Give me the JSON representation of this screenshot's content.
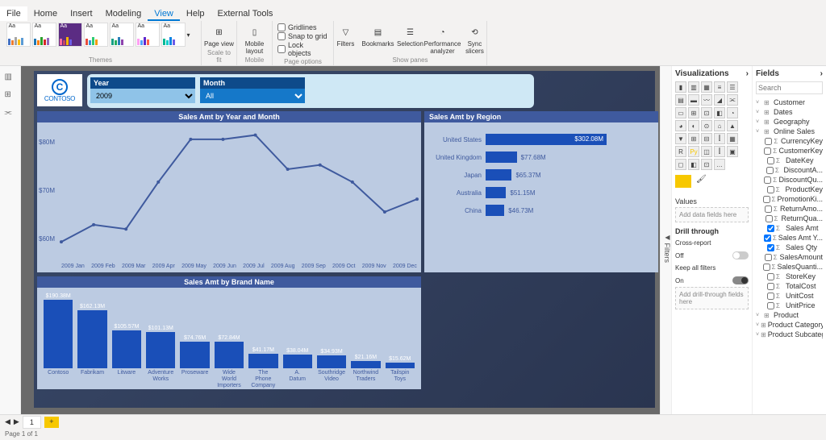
{
  "menu": {
    "file": "File",
    "home": "Home",
    "insert": "Insert",
    "modeling": "Modeling",
    "view": "View",
    "help": "Help",
    "external": "External Tools"
  },
  "ribbon": {
    "themes_label": "Themes",
    "scale_label": "Scale to fit",
    "mobile_label": "Mobile",
    "page_label": "Page options",
    "show_label": "Show panes",
    "page_view": "Page view",
    "mobile_layout": "Mobile layout",
    "gridlines": "Gridlines",
    "snap": "Snap to grid",
    "lock": "Lock objects",
    "filters": "Filters",
    "bookmarks": "Bookmarks",
    "selection": "Selection",
    "perf": "Performance analyzer",
    "sync": "Sync slicers"
  },
  "logo": {
    "name": "CONTOSO",
    "glyph": "C"
  },
  "slicers": {
    "year_label": "Year",
    "month_label": "Month",
    "year_value": "2009",
    "month_value": "All"
  },
  "titles": {
    "line": "Sales Amt by Year and Month",
    "region": "Sales Amt by Region",
    "brand": "Sales Amt by Brand Name"
  },
  "filters_label": "Filters",
  "viz": {
    "title": "Visualizations",
    "values": "Values",
    "values_drop": "Add data fields here",
    "drill": "Drill through",
    "cross": "Cross-report",
    "off": "Off",
    "keep": "Keep all filters",
    "on": "On",
    "drill_drop": "Add drill-through fields here"
  },
  "fields": {
    "title": "Fields",
    "search_placeholder": "Search",
    "tables": [
      "Customer",
      "Dates",
      "Geography",
      "Online Sales",
      "Product",
      "Product Category",
      "Product Subcateg..."
    ],
    "online_sales": [
      "CurrencyKey",
      "CustomerKey",
      "DateKey",
      "DiscountA...",
      "DiscountQu...",
      "ProductKey",
      "PromotionKi...",
      "ReturnAmo...",
      "ReturnQua...",
      "Sales Amt",
      "Sales Amt Y...",
      "Sales Qty",
      "SalesAmount",
      "SalesQuanti...",
      "StoreKey",
      "TotalCost",
      "UnitCost",
      "UnitPrice"
    ],
    "selected": [
      "Sales Amt",
      "Sales Amt Y...",
      "Sales Qty"
    ]
  },
  "pager": {
    "tab": "1",
    "page": "Page 1 of 1"
  },
  "chart_data": [
    {
      "type": "line",
      "title": "Sales Amt by Year and Month",
      "ylabel": "",
      "xlabel": "",
      "ylim": [
        55,
        85
      ],
      "y_ticks": [
        "$80M",
        "$70M",
        "$60M"
      ],
      "categories": [
        "2009 Jan",
        "2009 Feb",
        "2009 Mar",
        "2009 Apr",
        "2009 May",
        "2009 Jun",
        "2009 Jul",
        "2009 Aug",
        "2009 Sep",
        "2009 Oct",
        "2009 Nov",
        "2009 Dec"
      ],
      "values": [
        58,
        62,
        61,
        72,
        82,
        82,
        83,
        75,
        76,
        72,
        65,
        68
      ]
    },
    {
      "type": "bar",
      "title": "Sales Amt by Region",
      "orientation": "horizontal",
      "categories": [
        "United States",
        "United Kingdom",
        "Japan",
        "Australia",
        "China"
      ],
      "values": [
        302.08,
        77.68,
        65.37,
        51.15,
        46.73
      ],
      "labels": [
        "$302.08M",
        "$77.68M",
        "$65.37M",
        "$51.15M",
        "$46.73M"
      ]
    },
    {
      "type": "bar",
      "title": "Sales Amt by Brand Name",
      "categories": [
        "Contoso",
        "Fabrikam",
        "Litware",
        "Adventure Works",
        "Proseware",
        "Wide World Importers",
        "The Phone Company",
        "A. Datum",
        "Southridge Video",
        "Northwind Traders",
        "Tailspin Toys"
      ],
      "values": [
        190.38,
        162.13,
        105.57,
        101.13,
        74.76,
        72.84,
        41.17,
        38.04,
        34.93,
        21.16,
        15.62
      ],
      "labels": [
        "$190.38M",
        "$162.13M",
        "$105.57M",
        "$101.13M",
        "$74.76M",
        "$72.84M",
        "$41.17M",
        "$38.04M",
        "$34.93M",
        "$21.16M",
        "$15.62M"
      ]
    }
  ]
}
